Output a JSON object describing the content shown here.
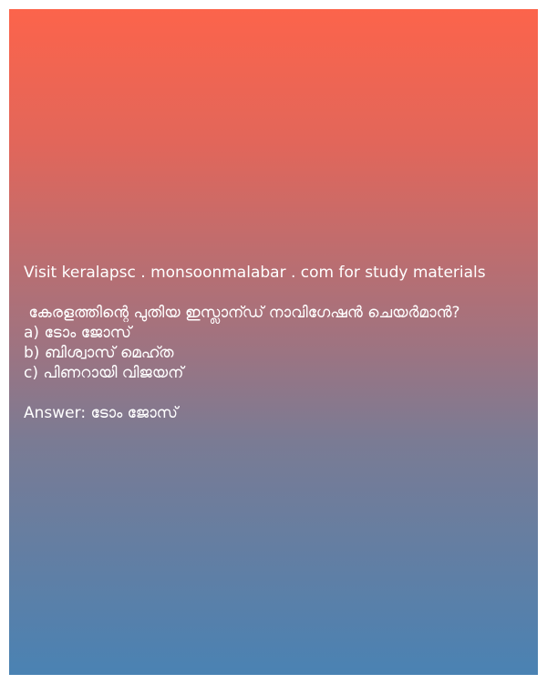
{
  "promo": "Visit keralapsc . monsoonmalabar . com for study materials",
  "question": " കേരളത്തിന്റെ പുതിയ ഇസ്ലാന്ഡ് നാവിഗേഷൻ ചെയർമാൻ?",
  "options": [
    "a) ടോം ജോസ്",
    "b) ബിശ്വാസ് മെഹ്ത",
    "c) പിണറായി വിജയന്"
  ],
  "answer": "Answer: ടോം ജോസ്",
  "colors": {
    "gradient_top": "#fc644b",
    "gradient_bottom": "#4a82b3",
    "text": "#ffffff"
  }
}
